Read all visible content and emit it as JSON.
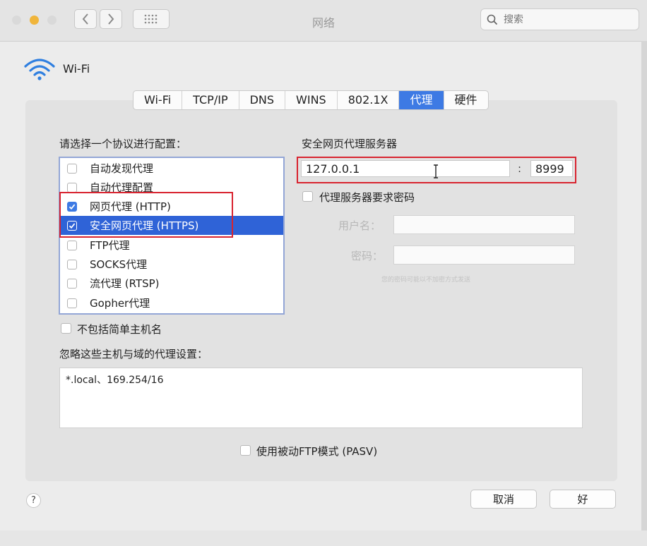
{
  "window": {
    "title": "网络",
    "search_placeholder": "搜索"
  },
  "interface": {
    "name": "Wi-Fi"
  },
  "tabs": [
    {
      "label": "Wi-Fi",
      "active": false
    },
    {
      "label": "TCP/IP",
      "active": false
    },
    {
      "label": "DNS",
      "active": false
    },
    {
      "label": "WINS",
      "active": false
    },
    {
      "label": "802.1X",
      "active": false
    },
    {
      "label": "代理",
      "active": true
    },
    {
      "label": "硬件",
      "active": false
    }
  ],
  "protocols": {
    "heading": "请选择一个协议进行配置：",
    "items": [
      {
        "label": "自动发现代理",
        "checked": false,
        "selected": false
      },
      {
        "label": "自动代理配置",
        "checked": false,
        "selected": false
      },
      {
        "label": "网页代理 (HTTP)",
        "checked": true,
        "selected": false
      },
      {
        "label": "安全网页代理 (HTTPS)",
        "checked": true,
        "selected": true
      },
      {
        "label": "FTP代理",
        "checked": false,
        "selected": false
      },
      {
        "label": "SOCKS代理",
        "checked": false,
        "selected": false
      },
      {
        "label": "流代理 (RTSP)",
        "checked": false,
        "selected": false
      },
      {
        "label": "Gopher代理",
        "checked": false,
        "selected": false
      }
    ]
  },
  "proxy_server": {
    "heading": "安全网页代理服务器",
    "host": "127.0.0.1",
    "separator": ":",
    "port": "8999",
    "require_password_label": "代理服务器要求密码",
    "require_password_checked": false,
    "username_label": "用户名：",
    "password_label": "密码：",
    "hint": "您的密码可能以不加密方式发送"
  },
  "exclude_simple_hostnames": {
    "label": "不包括简单主机名",
    "checked": false
  },
  "bypass": {
    "label": "忽略这些主机与域的代理设置：",
    "value": "*.local、169.254/16"
  },
  "passive_ftp": {
    "label": "使用被动FTP模式 (PASV)",
    "checked": false
  },
  "footer": {
    "help": "?",
    "cancel": "取消",
    "ok": "好"
  },
  "colors": {
    "accent": "#3d7ae4",
    "selection": "#2f63d7",
    "highlight_box": "#d8232f"
  }
}
